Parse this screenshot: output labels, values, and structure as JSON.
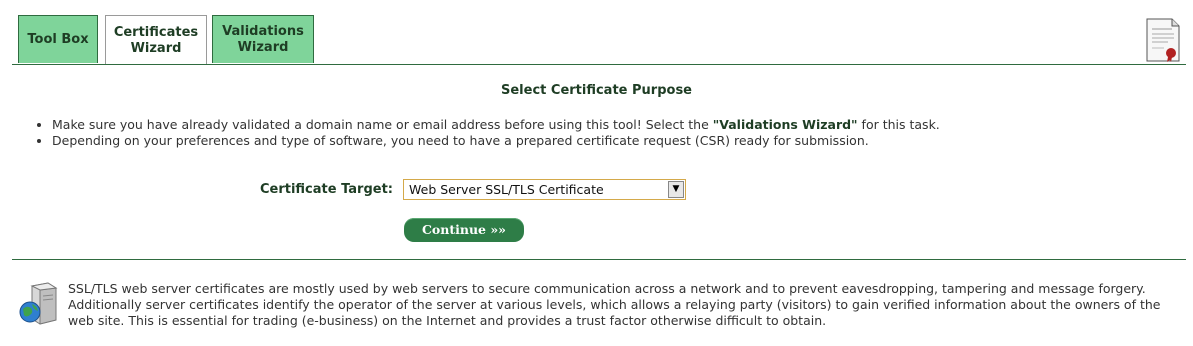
{
  "tabs": [
    {
      "label": "Tool Box",
      "active": false
    },
    {
      "label": "Certificates\nWizard",
      "active": true
    },
    {
      "label": "Validations\nWizard",
      "active": false
    }
  ],
  "heading": "Select Certificate Purpose",
  "notes": {
    "item1_pre": "Make sure you have already validated a domain name or email address before using this tool! Select the ",
    "item1_bold": "\"Validations Wizard\"",
    "item1_post": " for this task.",
    "item2": "Depending on your preferences and type of software, you need to have a prepared certificate request (CSR) ready for submission."
  },
  "form": {
    "target_label": "Certificate Target:",
    "target_value": "Web Server SSL/TLS Certificate",
    "continue_label": "Continue »»"
  },
  "info_text": "SSL/TLS web server certificates are mostly used by web servers to secure communication across a network and to prevent eavesdropping, tampering and message forgery. Additionally server certificates identify the operator of the server at various levels, which allows a relaying party (visitors) to gain verified information about the owners of the web site. This is essential for trading (e-business) on the Internet and provides a trust factor otherwise difficult to obtain.",
  "icons": {
    "certificate": "certificate-icon",
    "server": "server-icon",
    "dropdown": "chevron-down-icon"
  },
  "colors": {
    "accent_green": "#2e7d47",
    "tab_green": "#7fd49a",
    "heading_green": "#1e3d24"
  }
}
